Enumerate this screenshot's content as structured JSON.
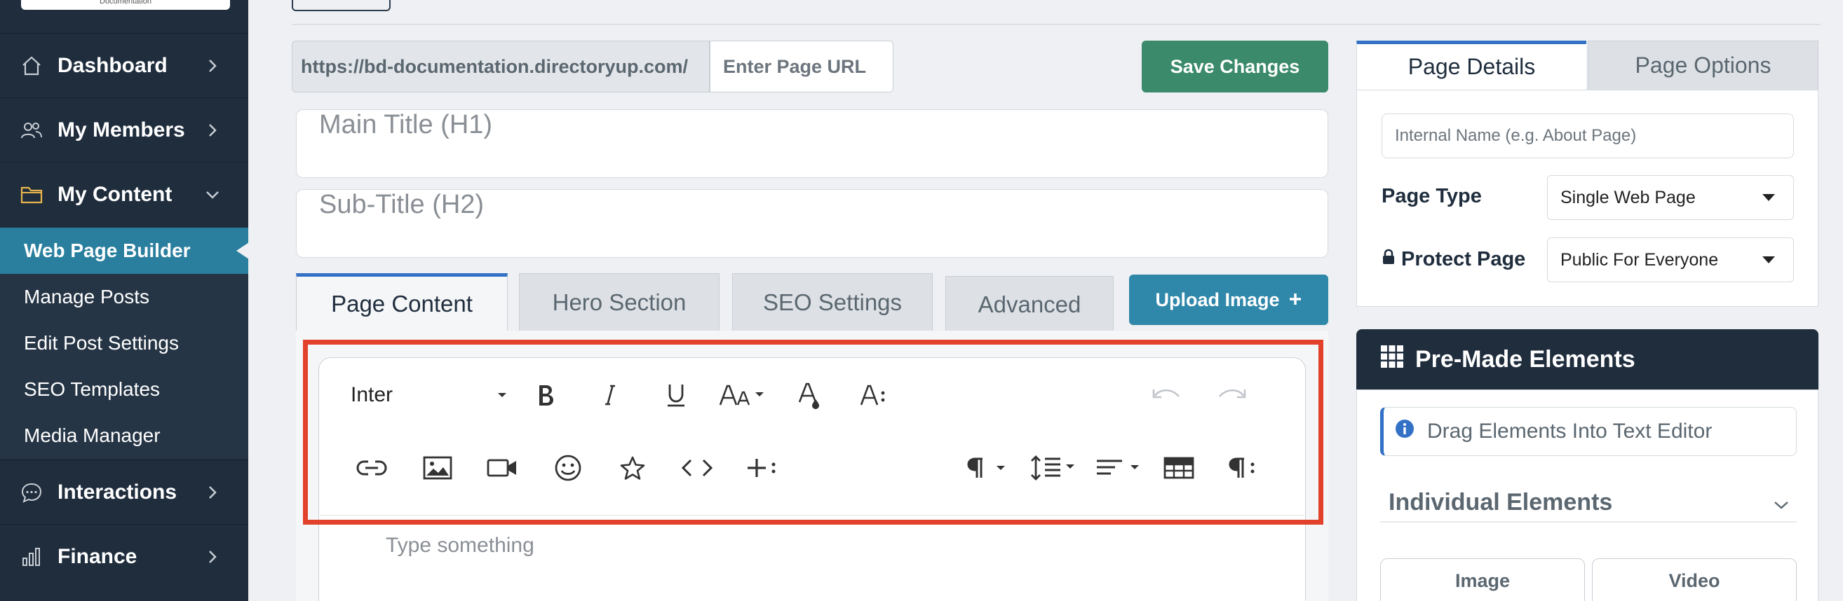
{
  "sidebar": {
    "logo_text": "Documentation",
    "items": [
      {
        "label": "Dashboard",
        "icon": "home-icon",
        "expanded": false
      },
      {
        "label": "My Members",
        "icon": "users-icon",
        "expanded": false
      },
      {
        "label": "My Content",
        "icon": "folder-icon",
        "expanded": true
      },
      {
        "label": "Interactions",
        "icon": "chat-icon",
        "expanded": false
      },
      {
        "label": "Finance",
        "icon": "bar-chart-icon",
        "expanded": false
      }
    ],
    "subitems": [
      {
        "label": "Web Page Builder",
        "active": true
      },
      {
        "label": "Manage Posts",
        "active": false
      },
      {
        "label": "Edit Post Settings",
        "active": false
      },
      {
        "label": "SEO Templates",
        "active": false
      },
      {
        "label": "Media Manager",
        "active": false
      }
    ]
  },
  "url_bar": {
    "prefix": "https://bd-documentation.directoryup.com/",
    "placeholder": "Enter Page URL"
  },
  "save_button": {
    "label": "Save Changes",
    "color": "#3a8a6b"
  },
  "main_title": {
    "placeholder": "Main Title (H1)"
  },
  "sub_title": {
    "placeholder": "Sub-Title (H2)"
  },
  "content_tabs": [
    {
      "label": "Page Content",
      "active": true
    },
    {
      "label": "Hero Section",
      "active": false
    },
    {
      "label": "SEO Settings",
      "active": false
    },
    {
      "label": "Advanced",
      "active": false
    }
  ],
  "upload_button": {
    "label": "Upload Image",
    "icon": "plus-icon",
    "color": "#2f87a9"
  },
  "editor": {
    "font": "Inter",
    "placeholder": "Type something",
    "toolbar_row1": [
      "font-family-dropdown",
      "bold-icon",
      "italic-icon",
      "underline-icon",
      "font-size-icon",
      "text-color-icon",
      "more-text-icon",
      "undo-icon",
      "redo-icon"
    ],
    "toolbar_row2": [
      "link-icon",
      "image-icon",
      "video-icon",
      "emoji-icon",
      "star-icon",
      "code-icon",
      "more-insert-icon",
      "paragraph-format-icon",
      "line-height-icon",
      "align-icon",
      "table-icon",
      "more-paragraph-icon"
    ]
  },
  "highlight_color": "#e2412c",
  "right_tabs": [
    {
      "label": "Page Details",
      "active": true
    },
    {
      "label": "Page Options",
      "active": false
    }
  ],
  "page_details": {
    "internal_name_placeholder": "Internal Name (e.g. About Page)",
    "page_type_label": "Page Type",
    "page_type_value": "Single Web Page",
    "protect_label": "Protect Page",
    "protect_value": "Public For Everyone"
  },
  "premade": {
    "title": "Pre-Made Elements",
    "info": "Drag Elements Into Text Editor",
    "section": "Individual Elements",
    "buttons": [
      "Image",
      "Video"
    ]
  },
  "accent_color": "#3371c7",
  "sidebar_active_color": "#2a7f9e"
}
